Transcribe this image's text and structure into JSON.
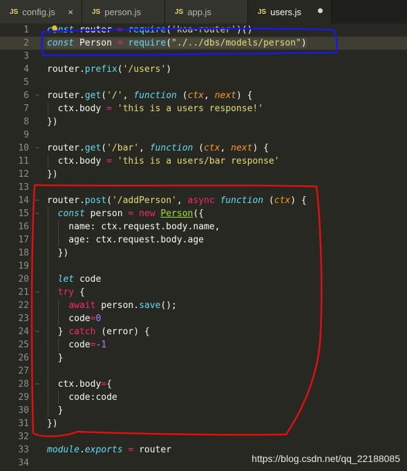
{
  "tabs": [
    {
      "icon": "JS",
      "label": "config.js",
      "close": "×"
    },
    {
      "icon": "JS",
      "label": "person.js"
    },
    {
      "icon": "JS",
      "label": "app.js"
    },
    {
      "icon": "JS",
      "label": "users.js",
      "active": true,
      "unsaved": true
    }
  ],
  "editor": {
    "highlighted_line": 2,
    "lines": [
      {
        "n": "1",
        "tokens": [
          [
            "st",
            "const"
          ],
          [
            "pl",
            " router "
          ],
          [
            "kw",
            "="
          ],
          [
            "pl",
            " "
          ],
          [
            "fn",
            "require"
          ],
          [
            "pl",
            "("
          ],
          [
            "str",
            "'koa-router'"
          ],
          [
            "pl",
            ")()"
          ]
        ]
      },
      {
        "n": "2",
        "tokens": [
          [
            "st",
            "const"
          ],
          [
            "pl",
            " Person "
          ],
          [
            "kw",
            "="
          ],
          [
            "pl",
            " "
          ],
          [
            "fn",
            "require"
          ],
          [
            "pl",
            "("
          ],
          [
            "str",
            "\"./../dbs/models/person\""
          ],
          [
            "pl",
            ")"
          ]
        ]
      },
      {
        "n": "3",
        "tokens": []
      },
      {
        "n": "4",
        "tokens": [
          [
            "pl",
            "router."
          ],
          [
            "fn",
            "prefix"
          ],
          [
            "pl",
            "("
          ],
          [
            "str",
            "'/users'"
          ],
          [
            "pl",
            ")"
          ]
        ]
      },
      {
        "n": "5",
        "tokens": []
      },
      {
        "n": "6",
        "tokens": [
          [
            "pl",
            "router."
          ],
          [
            "fn",
            "get"
          ],
          [
            "pl",
            "("
          ],
          [
            "str",
            "'/'"
          ],
          [
            "pl",
            ", "
          ],
          [
            "st",
            "function"
          ],
          [
            "pl",
            " ("
          ],
          [
            "par",
            "ctx"
          ],
          [
            "pl",
            ", "
          ],
          [
            "par",
            "next"
          ],
          [
            "pl",
            ") {"
          ]
        ]
      },
      {
        "n": "7",
        "tokens": [
          [
            "pl",
            "  ctx.body "
          ],
          [
            "kw",
            "="
          ],
          [
            "pl",
            " "
          ],
          [
            "str",
            "'this is a users response!'"
          ]
        ]
      },
      {
        "n": "8",
        "tokens": [
          [
            "pl",
            "})"
          ]
        ]
      },
      {
        "n": "9",
        "tokens": []
      },
      {
        "n": "10",
        "tokens": [
          [
            "pl",
            "router."
          ],
          [
            "fn",
            "get"
          ],
          [
            "pl",
            "("
          ],
          [
            "str",
            "'/bar'"
          ],
          [
            "pl",
            ", "
          ],
          [
            "st",
            "function"
          ],
          [
            "pl",
            " ("
          ],
          [
            "par",
            "ctx"
          ],
          [
            "pl",
            ", "
          ],
          [
            "par",
            "next"
          ],
          [
            "pl",
            ") {"
          ]
        ]
      },
      {
        "n": "11",
        "tokens": [
          [
            "pl",
            "  ctx.body "
          ],
          [
            "kw",
            "="
          ],
          [
            "pl",
            " "
          ],
          [
            "str",
            "'this is a users/bar response'"
          ]
        ]
      },
      {
        "n": "12",
        "tokens": [
          [
            "pl",
            "})"
          ]
        ]
      },
      {
        "n": "13",
        "tokens": []
      },
      {
        "n": "14",
        "tokens": [
          [
            "pl",
            "router."
          ],
          [
            "fn",
            "post"
          ],
          [
            "pl",
            "("
          ],
          [
            "str",
            "'/addPerson'"
          ],
          [
            "pl",
            ", "
          ],
          [
            "kw",
            "async"
          ],
          [
            "pl",
            " "
          ],
          [
            "st",
            "function"
          ],
          [
            "pl",
            " ("
          ],
          [
            "par",
            "ctx"
          ],
          [
            "pl",
            ") {"
          ]
        ]
      },
      {
        "n": "15",
        "tokens": [
          [
            "pl",
            "  "
          ],
          [
            "st",
            "const"
          ],
          [
            "pl",
            " person "
          ],
          [
            "kw",
            "="
          ],
          [
            "pl",
            " "
          ],
          [
            "kw",
            "new"
          ],
          [
            "pl",
            " "
          ],
          [
            "cls",
            "Person"
          ],
          [
            "pl",
            "({"
          ]
        ]
      },
      {
        "n": "16",
        "tokens": [
          [
            "pl",
            "    name: ctx.request.body.name,"
          ]
        ]
      },
      {
        "n": "17",
        "tokens": [
          [
            "pl",
            "    age: ctx.request.body.age"
          ]
        ]
      },
      {
        "n": "18",
        "tokens": [
          [
            "pl",
            "  })"
          ]
        ]
      },
      {
        "n": "19",
        "tokens": []
      },
      {
        "n": "20",
        "tokens": [
          [
            "pl",
            "  "
          ],
          [
            "st",
            "let"
          ],
          [
            "pl",
            " code"
          ]
        ]
      },
      {
        "n": "21",
        "tokens": [
          [
            "pl",
            "  "
          ],
          [
            "kw",
            "try"
          ],
          [
            "pl",
            " {"
          ]
        ]
      },
      {
        "n": "22",
        "tokens": [
          [
            "pl",
            "    "
          ],
          [
            "kw",
            "await"
          ],
          [
            "pl",
            " person."
          ],
          [
            "fn",
            "save"
          ],
          [
            "pl",
            "();"
          ]
        ]
      },
      {
        "n": "23",
        "tokens": [
          [
            "pl",
            "    code"
          ],
          [
            "kw",
            "="
          ],
          [
            "num",
            "0"
          ]
        ]
      },
      {
        "n": "24",
        "tokens": [
          [
            "pl",
            "  } "
          ],
          [
            "kw",
            "catch"
          ],
          [
            "pl",
            " (error) {"
          ]
        ]
      },
      {
        "n": "25",
        "tokens": [
          [
            "pl",
            "    code"
          ],
          [
            "kw",
            "="
          ],
          [
            "num",
            "-1"
          ]
        ]
      },
      {
        "n": "26",
        "tokens": [
          [
            "pl",
            "  }"
          ]
        ]
      },
      {
        "n": "27",
        "tokens": []
      },
      {
        "n": "28",
        "tokens": [
          [
            "pl",
            "  ctx.body"
          ],
          [
            "kw",
            "="
          ],
          [
            "pl",
            "{"
          ]
        ]
      },
      {
        "n": "29",
        "tokens": [
          [
            "pl",
            "    code:code"
          ]
        ]
      },
      {
        "n": "30",
        "tokens": [
          [
            "pl",
            "  }"
          ]
        ]
      },
      {
        "n": "31",
        "tokens": [
          [
            "pl",
            "})"
          ]
        ]
      },
      {
        "n": "32",
        "tokens": []
      },
      {
        "n": "33",
        "tokens": [
          [
            "st",
            "module"
          ],
          [
            "pl",
            "."
          ],
          [
            "st",
            "exports"
          ],
          [
            "pl",
            " "
          ],
          [
            "kw",
            "="
          ],
          [
            "pl",
            " router"
          ]
        ]
      },
      {
        "n": "34",
        "tokens": []
      }
    ],
    "fold_lines": [
      "6",
      "10",
      "14",
      "15",
      "21",
      "24",
      "28"
    ]
  },
  "annotations": {
    "blue": "#1a1adf",
    "red": "#e01010"
  },
  "watermark": "https://blog.csdn.net/qq_22188085"
}
